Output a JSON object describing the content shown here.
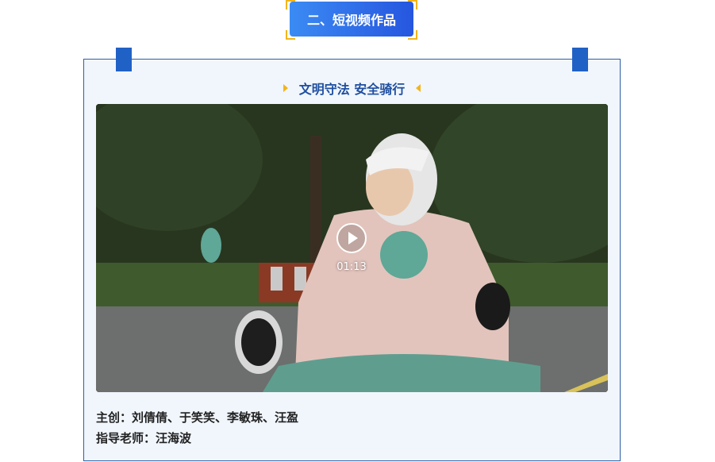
{
  "section": {
    "title": "二、短视频作品"
  },
  "work": {
    "title": "文明守法 安全骑行",
    "video": {
      "duration": "01:13"
    },
    "credits": {
      "creators": "主创：刘倩倩、于笑笑、李敏珠、汪盈",
      "advisor": "指导老师：汪海波"
    }
  },
  "colors": {
    "accent_blue": "#2656df",
    "frame_blue": "#2b5fa6",
    "accent_yellow": "#f2b51b",
    "card_bg": "#f1f6fd"
  }
}
